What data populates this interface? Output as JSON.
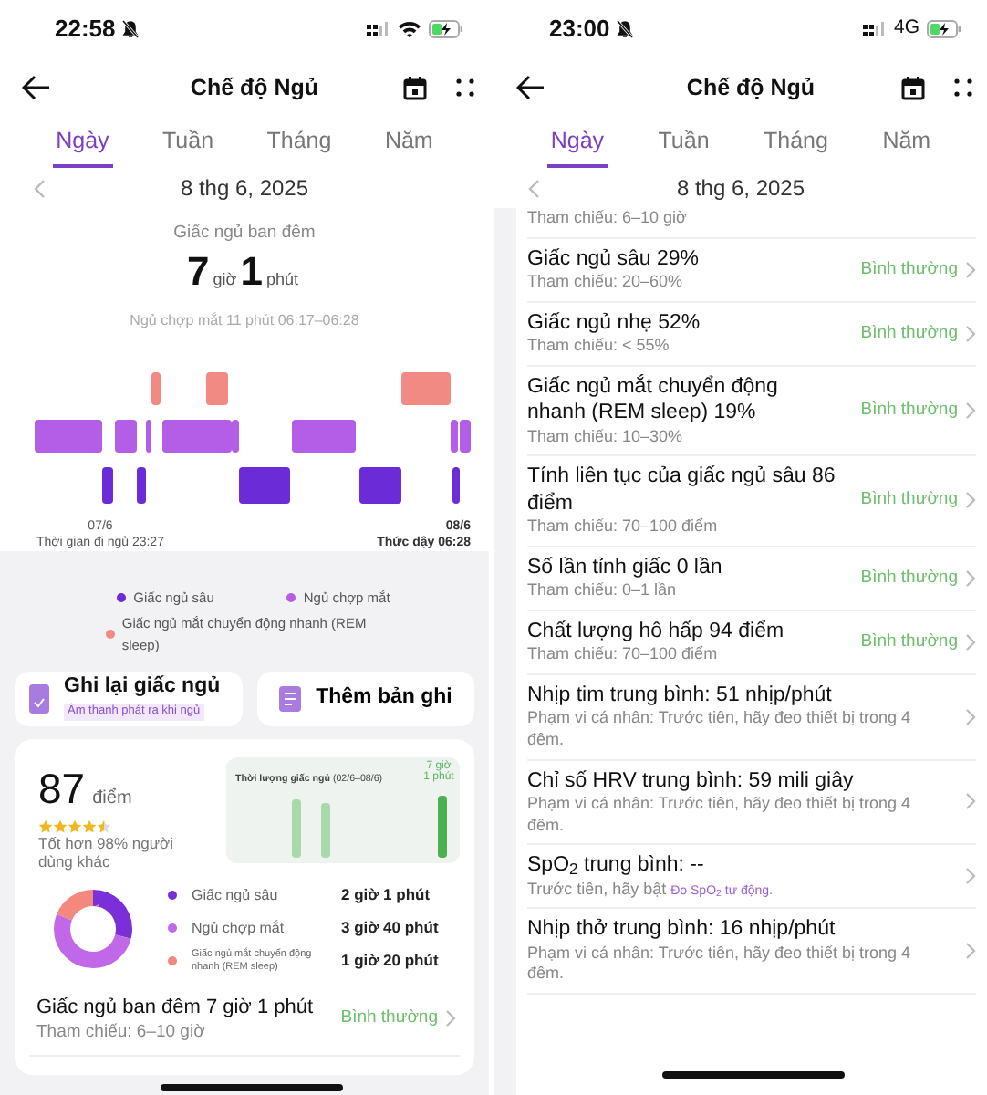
{
  "left_screen": {
    "status_bar": {
      "time": "22:58",
      "connection": {
        "kind": "wifi"
      }
    },
    "header": {
      "title": "Chế độ Ngủ"
    },
    "tabs": [
      {
        "label": "Ngày",
        "selected": true
      },
      {
        "label": "Tuần",
        "selected": false
      },
      {
        "label": "Tháng",
        "selected": false
      },
      {
        "label": "Năm",
        "selected": false
      }
    ],
    "date": "8 thg 6, 2025",
    "summary": {
      "label": "Giấc ngủ ban đêm",
      "hours": "7",
      "hours_unit": "giờ",
      "minutes": "1",
      "minutes_unit": "phút",
      "nap": "Ngủ chợp mắt 11 phút 06:17–06:28"
    },
    "hypnogram": {
      "start_date": "07/6",
      "start_label": "Thời gian đi ngủ 23:27",
      "end_date": "08/6",
      "end_label": "Thức dậy 06:28"
    },
    "legend": [
      {
        "label": "Giấc ngủ sâu",
        "color": "#6b2bd6"
      },
      {
        "label": "Ngủ chợp mắt",
        "color": "#b45de6"
      },
      {
        "label": "Giấc ngủ mắt chuyển động nhanh (REM sleep)",
        "color": "#f28a84"
      }
    ],
    "actions": [
      {
        "kind": "record",
        "label": "Ghi lại giấc ngủ",
        "tag": "Âm thanh phát ra khi ngủ"
      },
      {
        "kind": "add",
        "label": "Thêm bản ghi"
      }
    ],
    "score_card": {
      "score": "87",
      "unit": "điểm",
      "stars": 4.5,
      "comparison": "Tốt hơn 98% người dùng khác",
      "duration_chart": {
        "title": "**Thời lượng giấc ngủ** (02/6–08/6)",
        "latest": "7 giờ 1 phút"
      },
      "stages": [
        {
          "label": "Giấc ngủ sâu",
          "duration": "2 giờ 1 phút",
          "color": "#7b2fd8"
        },
        {
          "label": "Ngủ chợp mắt",
          "duration": "3 giờ 40 phút",
          "color": "#c068e8"
        },
        {
          "label": "Giấc ngủ mắt chuyển động nhanh (REM sleep)",
          "duration": "1 giờ 20 phút",
          "color": "#f4877e"
        }
      ],
      "metric": {
        "title": "Giấc ngủ ban đêm 7 giờ 1 phút",
        "reference": "Tham chiếu: 6–10 giờ",
        "status": "Bình thường"
      }
    }
  },
  "right_screen": {
    "status_bar": {
      "time": "23:00",
      "connection": {
        "kind": "cellular",
        "label": "4G"
      }
    },
    "header": {
      "title": "Chế độ Ngủ"
    },
    "tabs": [
      {
        "label": "Ngày",
        "selected": true
      },
      {
        "label": "Tuần",
        "selected": false
      },
      {
        "label": "Tháng",
        "selected": false
      },
      {
        "label": "Năm",
        "selected": false
      }
    ],
    "date": "8 thg 6, 2025",
    "metrics": [
      {
        "reference": "Tham chiếu: 6–10 giờ"
      },
      {
        "title": "Giấc ngủ sâu 29%",
        "reference": "Tham chiếu: 20–60%",
        "status": "Bình thường"
      },
      {
        "title": "Giấc ngủ nhẹ 52%",
        "reference": "Tham chiếu: < 55%",
        "status": "Bình thường"
      },
      {
        "title": "Giấc ngủ mắt chuyển động nhanh (REM sleep) 19%",
        "reference": "Tham chiếu: 10–30%",
        "status": "Bình thường"
      },
      {
        "title": "Tính liên tục của giấc ngủ sâu 86 điểm",
        "reference": "Tham chiếu: 70–100 điểm",
        "status": "Bình thường"
      },
      {
        "title": "Số lần tỉnh giấc 0 lần",
        "reference": "Tham chiếu: 0–1 lần",
        "status": "Bình thường"
      },
      {
        "title": "Chất lượng hô hấp 94 điểm",
        "reference": "Tham chiếu: 70–100 điểm",
        "status": "Bình thường"
      },
      {
        "title": "Nhịp tim trung bình: 51 nhịp/phút",
        "reference": "Phạm vi cá nhân: Trước tiên, hãy đeo thiết bị trong 4 đêm."
      },
      {
        "title": "Chỉ số HRV trung bình: 59 mili giây",
        "reference": "Phạm vi cá nhân: Trước tiên, hãy đeo thiết bị trong 4 đêm."
      },
      {
        "title": "SpO$_{2}$ trung bình: --",
        "reference": "Trước tiên, hãy bật",
        "link": "Đo SpO$_{2}$ tự động."
      },
      {
        "title": "Nhịp thở trung bình: 16 nhịp/phút",
        "reference": "Phạm vi cá nhân: Trước tiên, hãy đeo thiết bị trong 4 đêm."
      }
    ]
  }
}
